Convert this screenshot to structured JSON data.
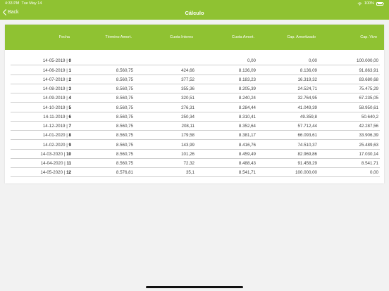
{
  "status": {
    "time": "4:33 PM",
    "date": "Tue May 14",
    "battery": "100%",
    "battery_level": 1.0
  },
  "nav": {
    "back_label": "Back",
    "title": "Cálculo"
  },
  "table": {
    "headers": [
      "Fecha",
      "Término Amort.",
      "Cuota Interes",
      "Cuota Amort.",
      "Cap. Amortizado",
      "Cap. Vivo"
    ],
    "rows": [
      {
        "date": "14-05-2019 |",
        "n": "0",
        "termino": "",
        "interes": "",
        "amort": "0,00",
        "amortizado": "0,00",
        "vivo": "100.000,00"
      },
      {
        "date": "14-06-2019 |",
        "n": "1",
        "termino": "8.560,75",
        "interes": "424,66",
        "amort": "8.136,09",
        "amortizado": "8.136,09",
        "vivo": "91.863,91"
      },
      {
        "date": "14-07-2019 |",
        "n": "2",
        "termino": "8.560,75",
        "interes": "377,52",
        "amort": "8.183,23",
        "amortizado": "16.319,32",
        "vivo": "83.680,68"
      },
      {
        "date": "14-08-2019 |",
        "n": "3",
        "termino": "8.560,75",
        "interes": "355,36",
        "amort": "8.205,39",
        "amortizado": "24.524,71",
        "vivo": "75.475,29"
      },
      {
        "date": "14-09-2019 |",
        "n": "4",
        "termino": "8.560,75",
        "interes": "320,51",
        "amort": "8.240,24",
        "amortizado": "32.764,95",
        "vivo": "67.235,05"
      },
      {
        "date": "14-10-2019 |",
        "n": "5",
        "termino": "8.560,75",
        "interes": "276,31",
        "amort": "8.284,44",
        "amortizado": "41.049,39",
        "vivo": "58.950,61"
      },
      {
        "date": "14-11-2019 |",
        "n": "6",
        "termino": "8.560,75",
        "interes": "250,34",
        "amort": "8.310,41",
        "amortizado": "49.359,8",
        "vivo": "50.640,2"
      },
      {
        "date": "14-12-2019 |",
        "n": "7",
        "termino": "8.560,75",
        "interes": "208,11",
        "amort": "8.352,64",
        "amortizado": "57.712,44",
        "vivo": "42.287,56"
      },
      {
        "date": "14-01-2020 |",
        "n": "8",
        "termino": "8.560,75",
        "interes": "179,58",
        "amort": "8.381,17",
        "amortizado": "66.093,61",
        "vivo": "33.906,39"
      },
      {
        "date": "14-02-2020 |",
        "n": "9",
        "termino": "8.560,75",
        "interes": "143,99",
        "amort": "8.416,76",
        "amortizado": "74.510,37",
        "vivo": "25.489,63"
      },
      {
        "date": "14-03-2020 |",
        "n": "10",
        "termino": "8.560,75",
        "interes": "101,26",
        "amort": "8.459,49",
        "amortizado": "82.969,86",
        "vivo": "17.030,14"
      },
      {
        "date": "14-04-2020 |",
        "n": "11",
        "termino": "8.560,75",
        "interes": "72,32",
        "amort": "8.488,43",
        "amortizado": "91.458,29",
        "vivo": "8.541,71"
      },
      {
        "date": "14-05-2020 |",
        "n": "12",
        "termino": "8.576,81",
        "interes": "35,1",
        "amort": "8.541,71",
        "amortizado": "100.000,00",
        "vivo": "0,00"
      }
    ]
  },
  "colors": {
    "accent": "#8fc232",
    "background": "#f2f2f2"
  }
}
